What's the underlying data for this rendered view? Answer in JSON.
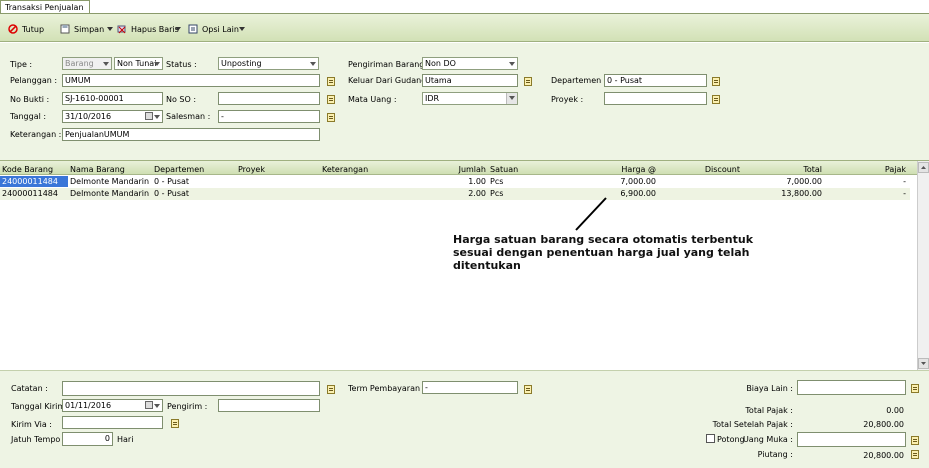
{
  "tab": {
    "label": "Transaksi Penjualan"
  },
  "toolbar": {
    "close_label": "Tutup",
    "save_label": "Simpan",
    "delete_row_label": "Hapus Baris",
    "other_options_label": "Opsi Lain"
  },
  "form": {
    "tipe_label": "Tipe :",
    "tipe_value": "Barang",
    "payment_value": "Non Tunai",
    "status_label": "Status :",
    "status_value": "Unposting",
    "pelanggan_label": "Pelanggan :",
    "pelanggan_value": "UMUM",
    "no_bukti_label": "No Bukti :",
    "no_bukti_value": "SJ-1610-00001",
    "no_so_label": "No SO :",
    "no_so_value": "",
    "tanggal_label": "Tanggal :",
    "tanggal_value": "31/10/2016",
    "salesman_label": "Salesman :",
    "salesman_value": "-",
    "keterangan_label": "Keterangan :",
    "keterangan_value": "PenjualanUMUM",
    "pengiriman_label": "Pengiriman Barang :",
    "pengiriman_value": "Non DO",
    "gudang_label": "Keluar Dari Gudang :",
    "gudang_value": "Utama",
    "mata_uang_label": "Mata Uang :",
    "mata_uang_value": "IDR",
    "departemen_label": "Departemen :",
    "departemen_value": "0 - Pusat",
    "proyek_label": "Proyek :",
    "proyek_value": ""
  },
  "grid": {
    "headers": {
      "kode": "Kode Barang",
      "nama": "Nama Barang",
      "departemen": "Departemen",
      "proyek": "Proyek",
      "keterangan": "Keterangan",
      "jumlah": "Jumlah",
      "satuan": "Satuan",
      "harga": "Harga @",
      "discount": "Discount",
      "total": "Total",
      "pajak": "Pajak"
    },
    "rows": [
      {
        "kode": "24000011484",
        "nama": "Delmonte Mandarin",
        "departemen": "0 - Pusat",
        "jumlah": "1.00",
        "satuan": "Pcs",
        "harga": "7,000.00",
        "total": "7,000.00",
        "pajak": "-"
      },
      {
        "kode": "24000011484",
        "nama": "Delmonte Mandarin",
        "departemen": "0 - Pusat",
        "jumlah": "2.00",
        "satuan": "Pcs",
        "harga": "6,900.00",
        "total": "13,800.00",
        "pajak": "-"
      }
    ]
  },
  "annotation": {
    "text": "Harga satuan barang secara otomatis terbentuk sesuai dengan penentuan harga jual yang telah ditentukan"
  },
  "footer": {
    "catatan_label": "Catatan :",
    "catatan_value": "",
    "tanggal_kirim_label": "Tanggal Kirim :",
    "tanggal_kirim_value": "01/11/2016",
    "pengirim_label": "Pengirim :",
    "pengirim_value": "",
    "kirim_via_label": "Kirim Via :",
    "kirim_via_value": "",
    "jatuh_tempo_label": "Jatuh Tempo :",
    "jatuh_tempo_value": "0",
    "hari_label": "Hari",
    "term_label": "Term Pembayaran :",
    "term_value": "-",
    "biaya_lain_label": "Biaya Lain :",
    "biaya_lain_value": "",
    "total_pajak_label": "Total Pajak :",
    "total_pajak_value": "0.00",
    "total_setelah_pajak_label": "Total Setelah Pajak :",
    "total_setelah_pajak_value": "20,800.00",
    "potong_label": "Potong",
    "uang_muka_label": "Uang Muka :",
    "uang_muka_value": "",
    "piutang_label": "Piutang :",
    "piutang_value": "20,800.00"
  },
  "colors": {
    "accent": "#d2e1b6",
    "panel": "#eef4e4",
    "selected_cell": "#3a76d8",
    "row_alt": "#eef3e2"
  },
  "icons": [
    "close-icon",
    "save-icon",
    "delete-row-icon",
    "options-icon",
    "lookup-icon",
    "calendar-icon",
    "chevron-down-icon"
  ]
}
